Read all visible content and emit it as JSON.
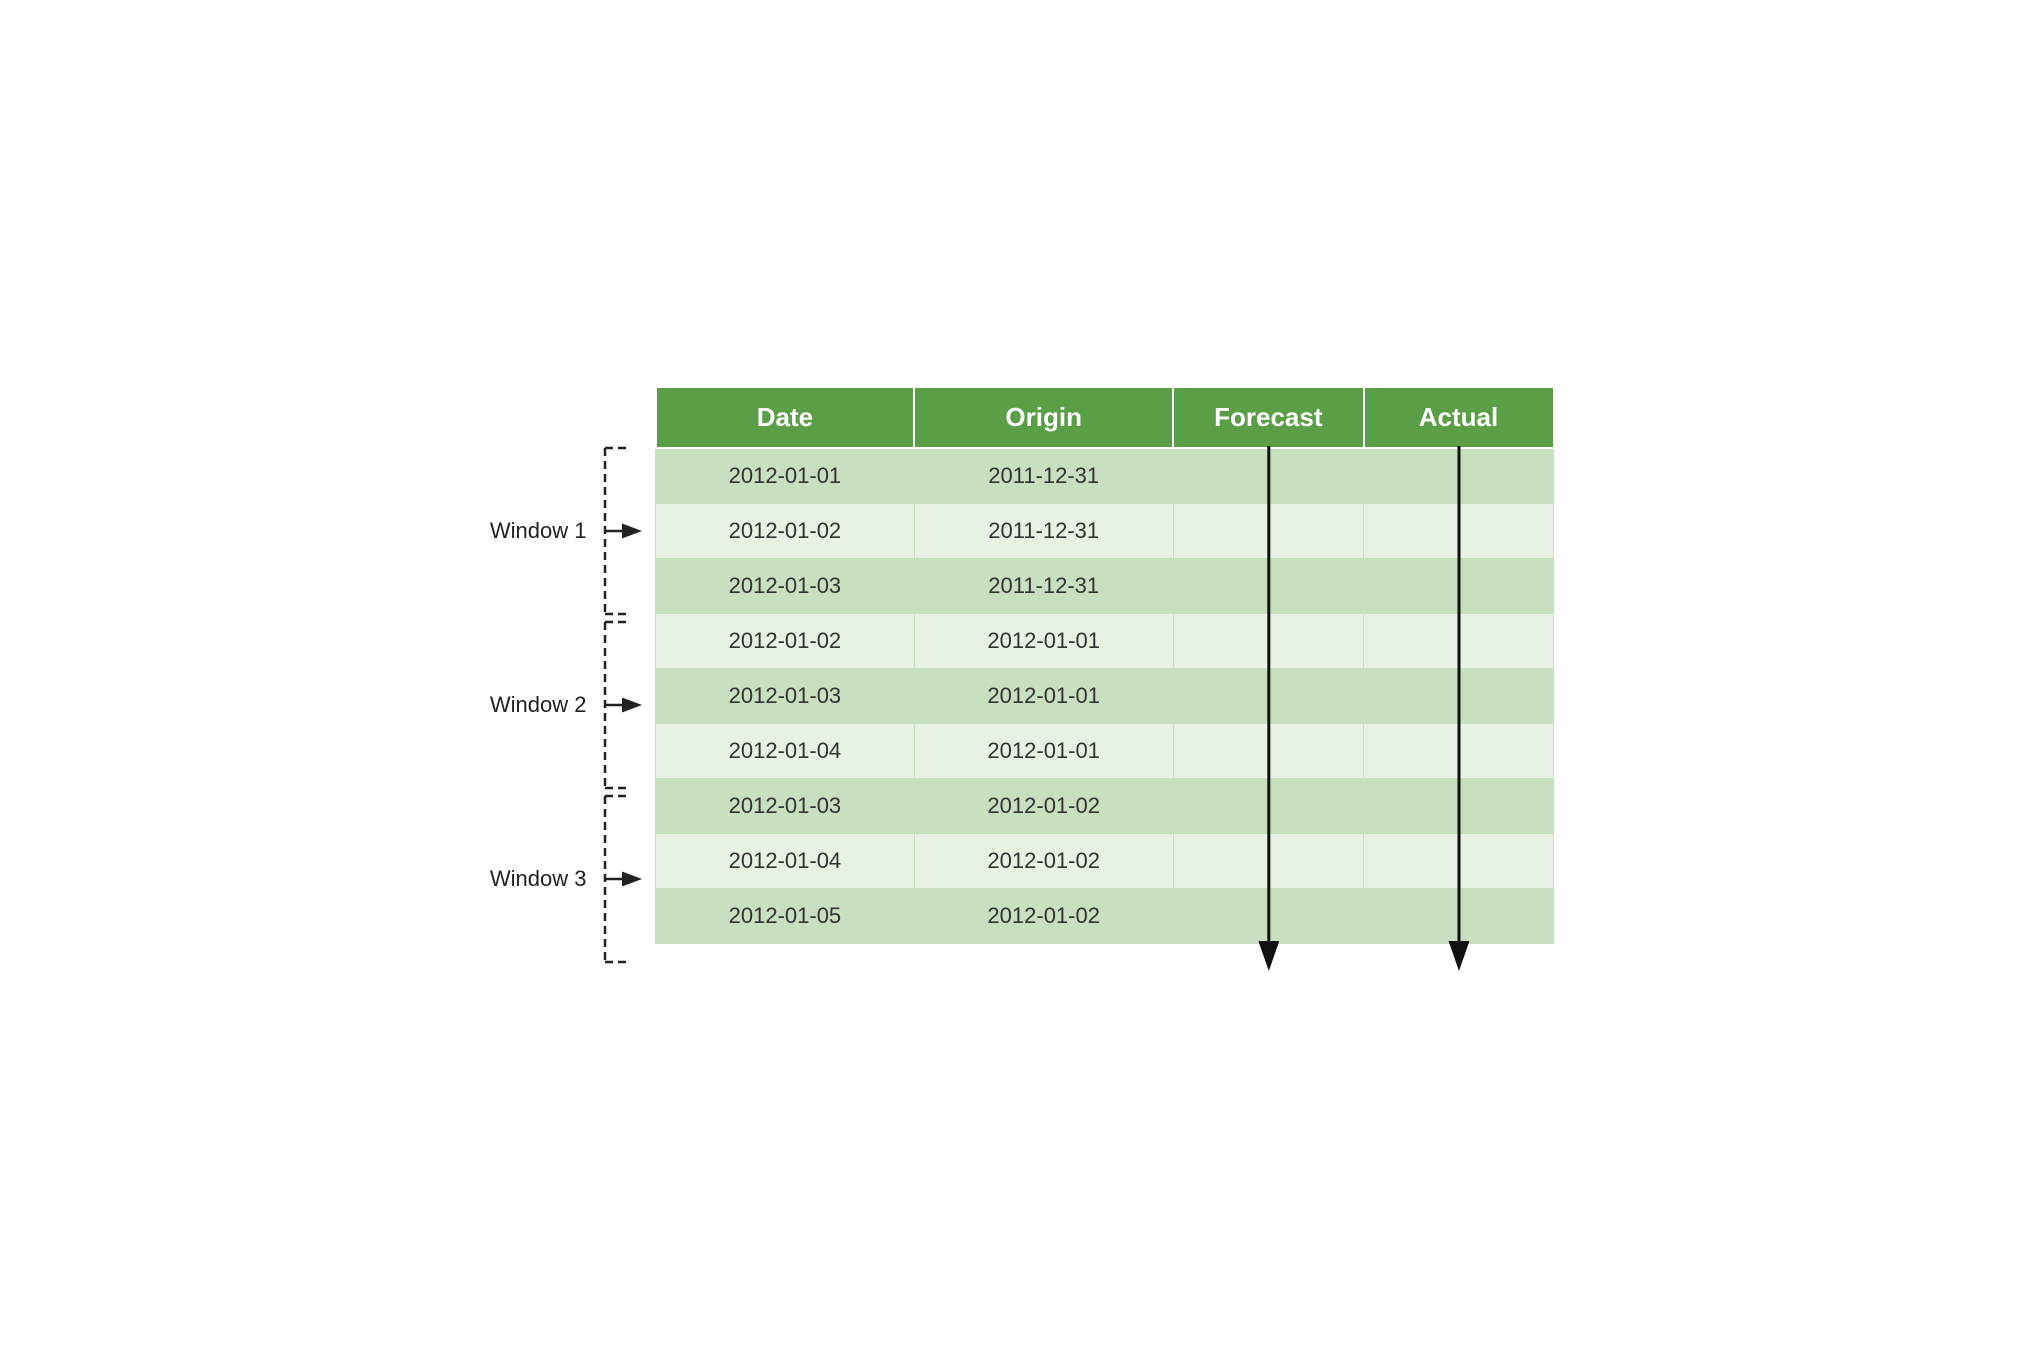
{
  "table": {
    "headers": [
      "Date",
      "Origin",
      "Forecast",
      "Actual"
    ],
    "rows": [
      {
        "window": 1,
        "shade": "dark",
        "date": "2012-01-01",
        "origin": "2011-12-31"
      },
      {
        "window": 1,
        "shade": "light",
        "date": "2012-01-02",
        "origin": "2011-12-31"
      },
      {
        "window": 1,
        "shade": "dark",
        "date": "2012-01-03",
        "origin": "2011-12-31"
      },
      {
        "window": 2,
        "shade": "light",
        "date": "2012-01-02",
        "origin": "2012-01-01"
      },
      {
        "window": 2,
        "shade": "dark",
        "date": "2012-01-03",
        "origin": "2012-01-01"
      },
      {
        "window": 2,
        "shade": "light",
        "date": "2012-01-04",
        "origin": "2012-01-01"
      },
      {
        "window": 3,
        "shade": "dark",
        "date": "2012-01-03",
        "origin": "2012-01-02"
      },
      {
        "window": 3,
        "shade": "light",
        "date": "2012-01-04",
        "origin": "2012-01-02"
      },
      {
        "window": 3,
        "shade": "dark",
        "date": "2012-01-05",
        "origin": "2012-01-02"
      }
    ],
    "windows": [
      {
        "label": "Window 1",
        "startRow": 0,
        "rowCount": 3
      },
      {
        "label": "Window 2",
        "startRow": 3,
        "rowCount": 3
      },
      {
        "label": "Window 3",
        "startRow": 6,
        "rowCount": 3
      }
    ]
  },
  "colors": {
    "header_bg": "#5a9e46",
    "row_dark": "#c8dfc0",
    "row_light": "#e8f2e4",
    "arrow": "#111",
    "bracket": "#222"
  }
}
